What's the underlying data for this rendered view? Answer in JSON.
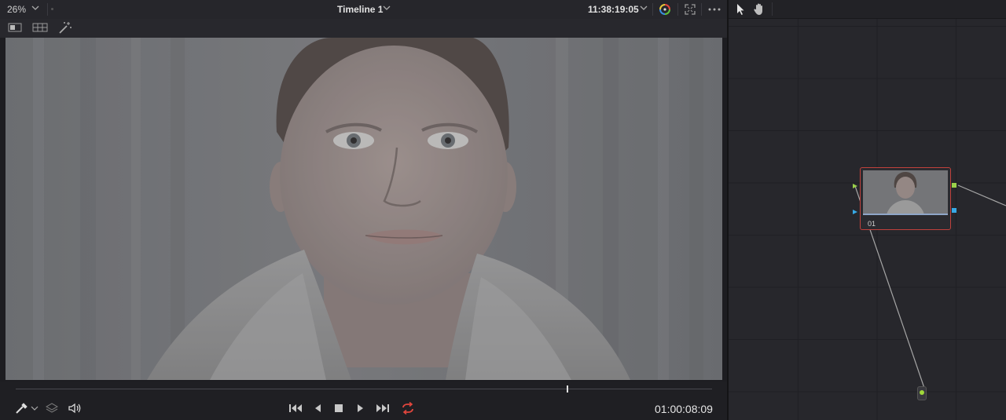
{
  "viewer": {
    "zoom": "26%",
    "timeline_name": "Timeline 1",
    "source_timecode": "11:38:19:05",
    "record_timecode": "01:00:08:09",
    "playhead_position": 0.792
  },
  "nodes": {
    "node_01_label": "01"
  },
  "colors": {
    "loop_active": "#e2463d",
    "node_selected_border": "#c0413c",
    "rgb_port": "#9ad14a",
    "alpha_port": "#37a9e6"
  },
  "icons": [
    "chevron-down-icon",
    "color-wheel-icon",
    "fullscreen-icon",
    "more-icon",
    "single-view-icon",
    "grid-view-icon",
    "magic-wand-icon",
    "color-picker-icon",
    "layers-icon",
    "speaker-icon",
    "skip-first-icon",
    "step-back-icon",
    "stop-icon",
    "play-icon",
    "skip-last-icon",
    "loop-icon",
    "pointer-icon",
    "hand-icon"
  ]
}
